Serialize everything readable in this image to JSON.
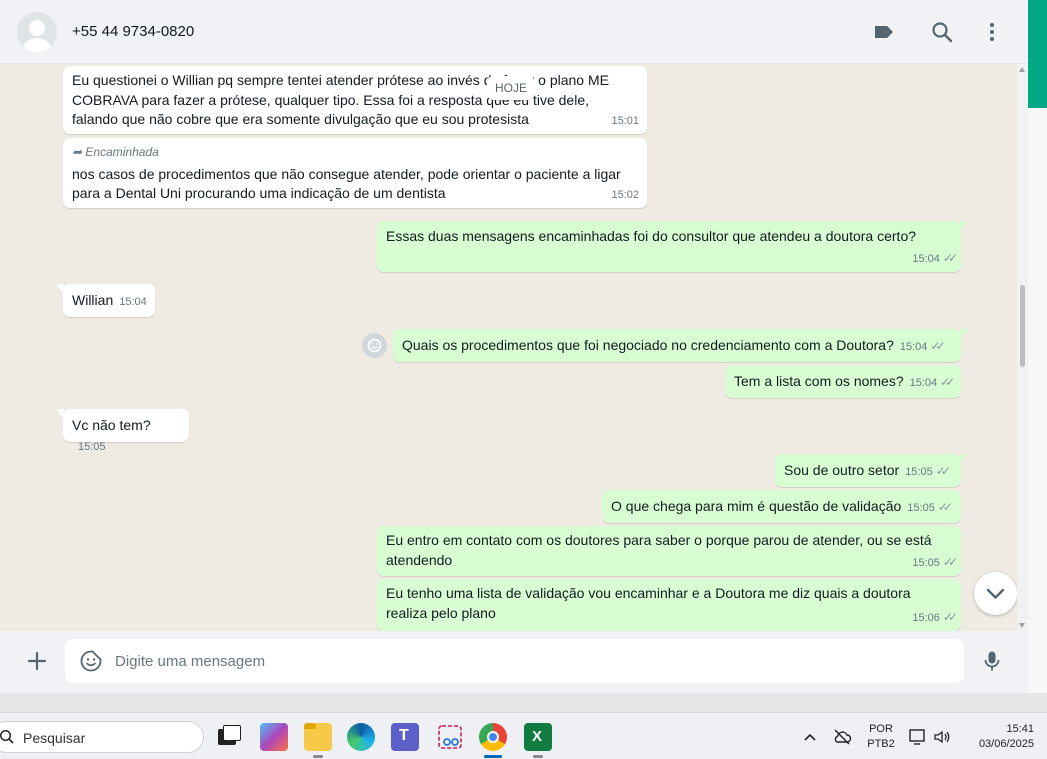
{
  "header": {
    "contact_name": "+55 44 9734-0820",
    "icons": [
      "label-icon",
      "search-icon",
      "menu-icon"
    ]
  },
  "date_chip": "HOJE",
  "messages": [
    {
      "dir": "in",
      "text": "Eu questionei o Willian pq sempre tentei atender prótese ao invés de fazer o plano ME COBRAVA para fazer a prótese, qualquer tipo. Essa foi a resposta que eu tive dele, falando que não cobre que era somente divulgação que eu sou protesista",
      "time": "15:01"
    },
    {
      "dir": "in",
      "forwarded": "Encaminhada",
      "text": "nos casos de procedimentos que não consegue atender, pode orientar o paciente a ligar para a Dental Uni procurando uma indicação de um dentista",
      "time": "15:02"
    },
    {
      "dir": "out",
      "text": "Essas duas mensagens encaminhadas foi do consultor que atendeu a doutora certo?",
      "time": "15:04"
    },
    {
      "dir": "in",
      "text": "Willian",
      "time": "15:04"
    },
    {
      "dir": "out",
      "text": "Quais os procedimentos que foi negociado no credenciamento com a Doutora?",
      "time": "15:04"
    },
    {
      "dir": "out",
      "text": "Tem a lista com os nomes?",
      "time": "15:04"
    },
    {
      "dir": "in",
      "text": "Vc não tem?",
      "time": "15:05"
    },
    {
      "dir": "out",
      "text": "Sou de outro setor",
      "time": "15:05"
    },
    {
      "dir": "out",
      "text": "O que chega para mim é questão de validação",
      "time": "15:05"
    },
    {
      "dir": "out",
      "text": "Eu entro em contato com os doutores para saber o porque parou de atender, ou se está atendendo",
      "time": "15:05"
    },
    {
      "dir": "out",
      "text": "Eu tenho uma lista de validação vou encaminhar e a Doutora me diz quais a doutora realiza pelo plano",
      "time": "15:06"
    }
  ],
  "composer": {
    "placeholder": "Digite uma mensagem"
  },
  "taskbar": {
    "search_label": "Pesquisar",
    "lang_line1": "POR",
    "lang_line2": "PTB2",
    "time": "15:41",
    "date": "03/06/2025"
  },
  "colors": {
    "incoming_bubble": "#ffffff",
    "outgoing_bubble": "#d9fdd3",
    "accent": "#00a884",
    "chat_background": "#efeae2"
  }
}
